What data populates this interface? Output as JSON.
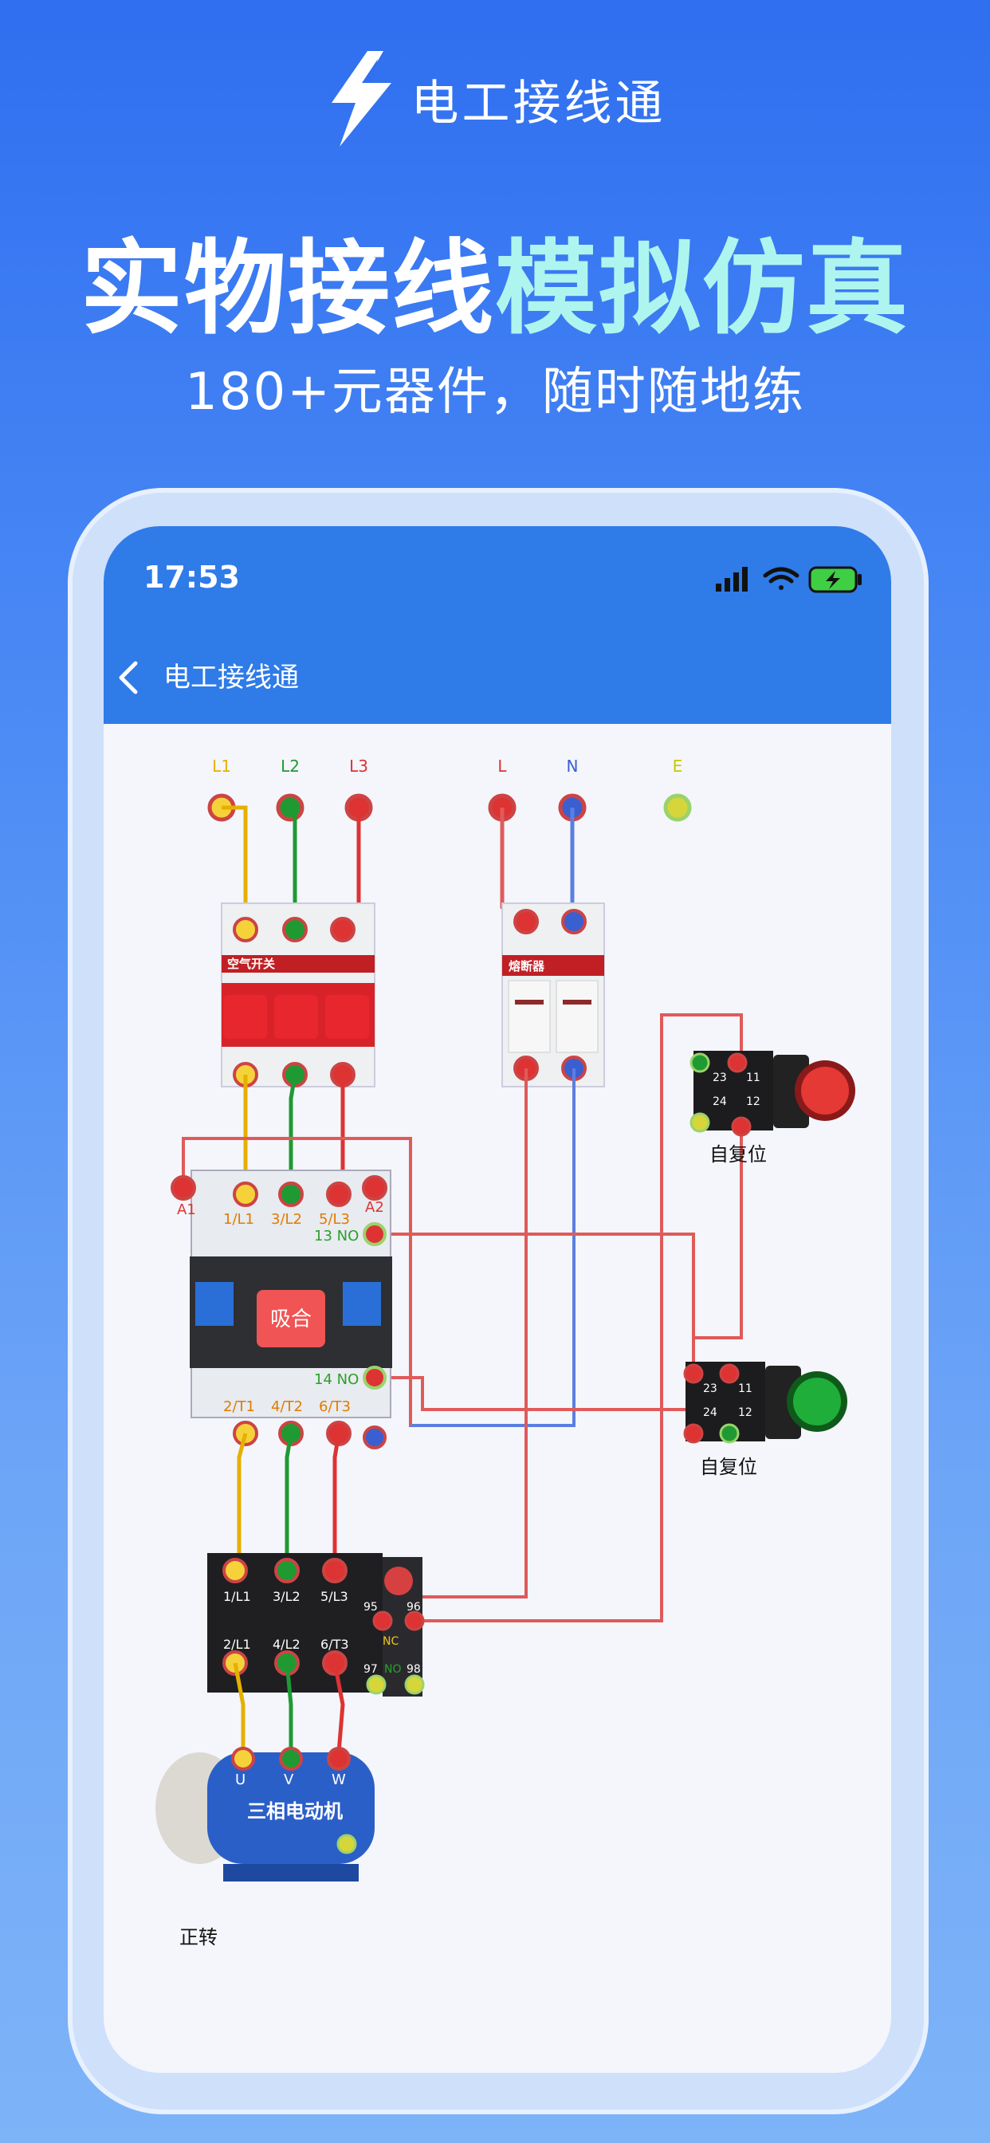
{
  "app_name": "电工接线通",
  "headline_white": "实物接线",
  "headline_cyan": "模拟仿真",
  "subtitle": "180+元器件，随时随地练",
  "status_time": "17:53",
  "nav_title": "电工接线通",
  "terminals": {
    "l1": "L1",
    "l2": "L2",
    "l3": "L3",
    "l": "L",
    "n": "N",
    "e": "E"
  },
  "breaker_label": "空气开关",
  "fuse_label": "熔断器",
  "contactor": {
    "a1": "A1",
    "a2": "A2",
    "in1": "1/L1",
    "in2": "3/L2",
    "in3": "5/L3",
    "no13": "13 NO",
    "no14": "14 NO",
    "out1": "2/T1",
    "out2": "4/T2",
    "out3": "6/T3",
    "state": "吸合"
  },
  "overload": {
    "in1": "1/L1",
    "in2": "3/L2",
    "in3": "5/L3",
    "out1": "2/L1",
    "out2": "4/L2",
    "out3": "6/T3",
    "t95": "95",
    "t96": "96",
    "nc": "NC",
    "t97": "97",
    "no": "NO",
    "t98": "98"
  },
  "button_red_label": "自复位",
  "button_green_label": "自复位",
  "button_terms": {
    "t23": "23",
    "t24": "24",
    "t11": "11",
    "t12": "12"
  },
  "motor_label": "三相电动机",
  "motor_terms": {
    "u": "U",
    "v": "V",
    "w": "W"
  },
  "motor_direction": "正转",
  "colors": {
    "accent": "#2f7be8",
    "wire_red": "#e05a5a",
    "wire_blue": "#5b7fe0",
    "wire_yellow": "#f0c419",
    "wire_green": "#1f9a33",
    "headline_cyan": "#aef5f0"
  },
  "icons": [
    "bolt-icon",
    "signal-icon",
    "wifi-icon",
    "battery-icon",
    "back-chevron-icon"
  ]
}
